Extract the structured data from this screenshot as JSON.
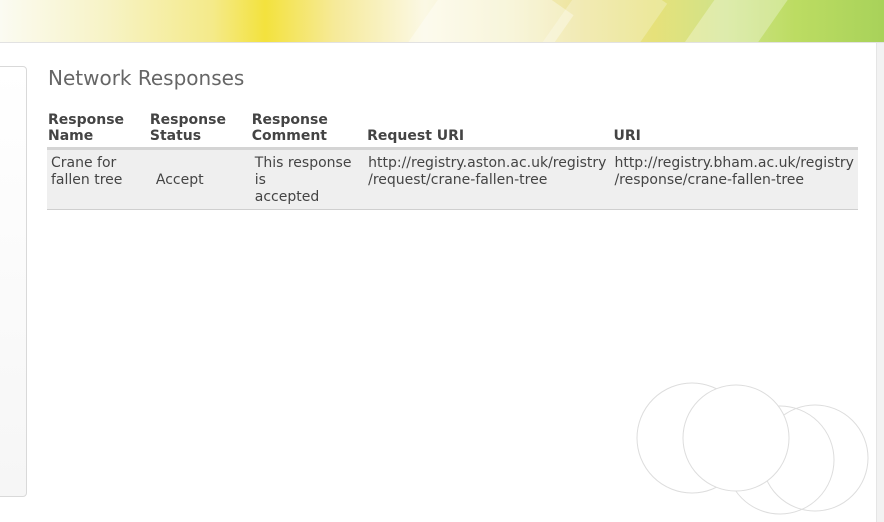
{
  "page": {
    "title": "Network Responses"
  },
  "table": {
    "headers": {
      "response_name": [
        "Response",
        "Name"
      ],
      "response_status": [
        "Response",
        "Status"
      ],
      "response_comment": [
        "Response",
        "Comment"
      ],
      "request_uri": "Request URI",
      "uri": "URI"
    },
    "rows": [
      {
        "name": [
          "Crane for",
          "fallen tree"
        ],
        "status": "Accept",
        "comment": [
          "This response is",
          "accepted"
        ],
        "request_uri": [
          "http://registry.aston.ac.uk/registry",
          "/request/crane-fallen-tree"
        ],
        "uri": [
          "http://registry.bham.ac.uk/registry",
          "/response/crane-fallen-tree"
        ]
      }
    ]
  }
}
